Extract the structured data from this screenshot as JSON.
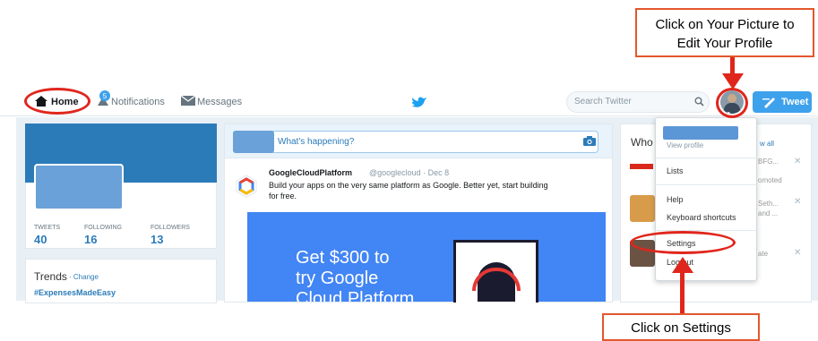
{
  "nav": {
    "home": "Home",
    "notifications": "Notifications",
    "notifications_count": "5",
    "messages": "Messages",
    "search_placeholder": "Search Twitter",
    "tweet_button": "Tweet"
  },
  "profile": {
    "stats": [
      {
        "label": "TWEETS",
        "value": "40"
      },
      {
        "label": "FOLLOWING",
        "value": "16"
      },
      {
        "label": "FOLLOWERS",
        "value": "13"
      }
    ]
  },
  "trends": {
    "title": "Trends",
    "change": "· Change",
    "first": "#ExpensesMadeEasy"
  },
  "compose": {
    "placeholder": "What's happening?"
  },
  "tweet": {
    "name": "GoogleCloudPlatform",
    "handle": "@googlecloud · Dec 8",
    "text_line1": "Build your apps on the very same platform as Google. Better yet, start building",
    "text_line2": "for free.",
    "ad_line1": "Get $300 to",
    "ad_line2": "try Google",
    "ad_line3": "Cloud Platform"
  },
  "who": {
    "title": "Who",
    "view_all": "w all",
    "row1_a": "BFG...",
    "row1_b": "omoted",
    "row2_a": "Seth...",
    "row2_b": "and ...",
    "row3_a": "ate"
  },
  "dropdown": {
    "view_profile": "View profile",
    "lists": "Lists",
    "help": "Help",
    "keyboard": "Keyboard shortcuts",
    "settings": "Settings",
    "logout": "Log out"
  },
  "annotations": {
    "top_callout_line1": "Click on Your Picture to",
    "top_callout_line2": "Edit Your Profile",
    "bottom_callout": "Click on Settings",
    "color": "#e0261c"
  },
  "colors": {
    "brand": "#1da1f2",
    "accent": "#2b7bb9"
  }
}
